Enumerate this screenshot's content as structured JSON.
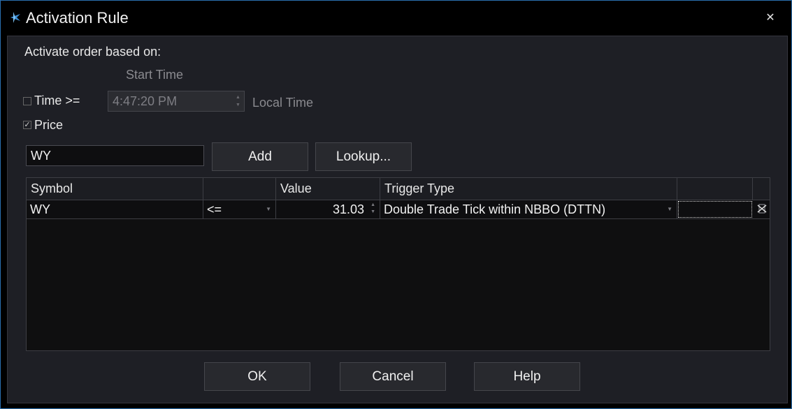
{
  "window": {
    "title": "Activation Rule",
    "close_glyph": "✕",
    "accent_color": "#2a6fb0"
  },
  "form": {
    "heading": "Activate order based on:",
    "start_time_label": "Start Time",
    "time_checkbox": {
      "label": "Time >=",
      "checked": false
    },
    "time_value": "4:47:20 PM",
    "time_zone_label": "Local Time",
    "price_checkbox": {
      "label": "Price",
      "checked": true,
      "glyph": "✓"
    },
    "symbol_input_value": "WY",
    "add_button": "Add",
    "lookup_button": "Lookup..."
  },
  "grid": {
    "columns": [
      "Symbol",
      "",
      "Value",
      "Trigger Type",
      ""
    ],
    "rows": [
      {
        "symbol": "WY",
        "operator": "<=",
        "value": "31.03",
        "trigger_type": "Double Trade Tick within NBBO (DTTN)"
      }
    ]
  },
  "footer": {
    "ok_button": "OK",
    "cancel_button": "Cancel",
    "help_button": "Help"
  },
  "icons": {
    "app": "app-logo-icon",
    "close": "close-icon",
    "dropdown": "chevron-down-icon",
    "spinner": "spinner-arrows-icon",
    "delete": "delete-row-icon"
  }
}
